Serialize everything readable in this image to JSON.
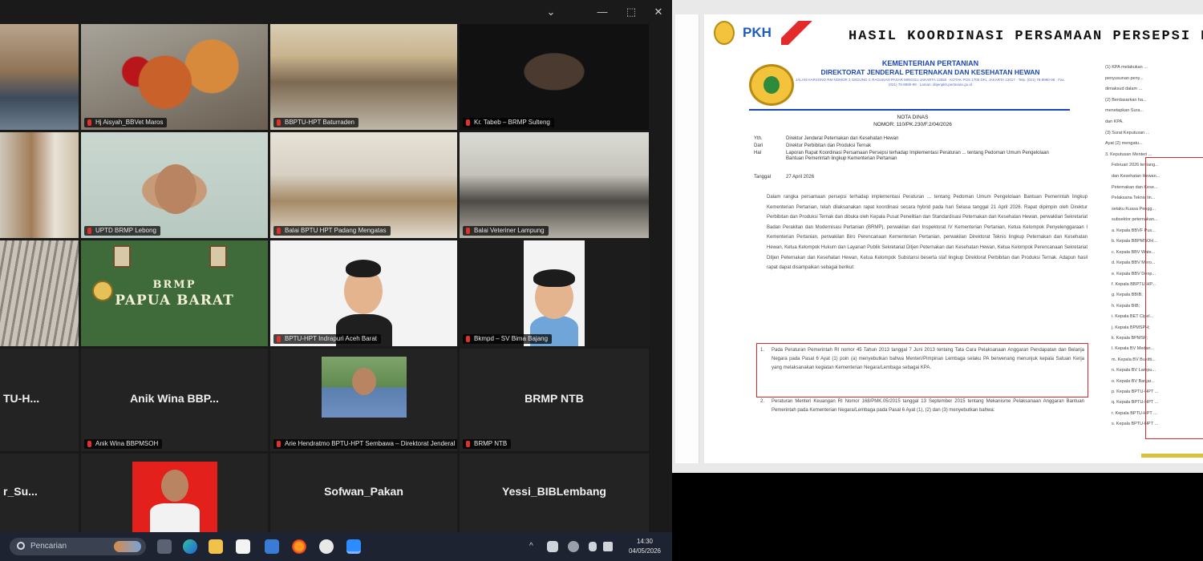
{
  "meeting": {
    "window_controls": [
      "⌄",
      "—",
      "⬚",
      "✕"
    ],
    "tiles": [
      {
        "label": ""
      },
      {
        "label": "Hj Aisyah_BBVet Maros"
      },
      {
        "label": "BBPTU-HPT Baturraden"
      },
      {
        "label": "Kr. Tabeb – BRMP Sulteng"
      },
      {
        "label": ""
      },
      {
        "label": "UPTD BRMP Lebong"
      },
      {
        "label": "Balai BPTU HPT Padang Mengatas"
      },
      {
        "label": "Balai Veteriner Lampung"
      },
      {
        "label": ""
      },
      {
        "label": ""
      },
      {
        "label": "BPTU-HPT Indrapuri Aceh Barat"
      },
      {
        "label": "Bkmpd – SV Bima Bajang"
      }
    ],
    "brmp_sign": {
      "line1": "BRMP",
      "line2": "PAPUA BARAT"
    },
    "name_tiles": [
      {
        "big": "TU-H...",
        "label": ""
      },
      {
        "big": "Anik Wina BBP...",
        "label": "Anik Wina BBPMSOH"
      },
      {
        "big": "",
        "label": "Arie Hendratmo BPTU-HPT Sembawa – Direktorat Jenderal PKH"
      },
      {
        "big": "BRMP NTB",
        "label": "BRMP NTB"
      },
      {
        "big": "r_Su...",
        "label": ""
      },
      {
        "big": "",
        "label": ""
      },
      {
        "big": "Sofwan_Pakan",
        "label": ""
      },
      {
        "big": "Yessi_BIBLembang",
        "label": ""
      }
    ]
  },
  "taskbar": {
    "search_placeholder": "Pencarian",
    "clock_time": "14:30",
    "clock_date": "04/05/2026",
    "tray_chevron": "^"
  },
  "document": {
    "title": "HASIL KOORDINASI PERSAMAAN PERSEPSI PERM",
    "logos": [
      "PKH"
    ],
    "letterhead": {
      "kementerian": "KEMENTERIAN PERTANIAN",
      "direktorat": "DIREKTORAT JENDERAL PETERNAKAN DAN KESEHATAN HEWAN",
      "address": "JALAN HARSONO RM NOMOR 3 GEDUNG C RAGUNAN PASAR MINGGU JAKARTA 12550 · KOTAK POS 1705 DKI, JAKARTA 12017 · Telp. (021) 78-8990-98 · Fax. (021) 78-8990-98 · Laman: ditjenpkh.pertanian.go.id"
    },
    "nota": {
      "title": "NOTA DINAS",
      "nomor": "NOMOR: 110/PK.230/F.2/04/2026"
    },
    "header_rows": [
      {
        "k": "Yth.",
        "v": "Direktur Jenderal Peternakan dan Kesehatan Hewan"
      },
      {
        "k": "Dari",
        "v": "Direktur Perbibitan dan Produksi Ternak"
      },
      {
        "k": "Hal",
        "v": "Laporan Rapat Koordinasi Persamaan Persepsi terhadap Implementasi Peraturan ... tentang Pedoman Umum Pengelolaan Bantuan Pemerintah lingkup Kementerian Pertanian"
      },
      {
        "k": "Tanggal",
        "v": "27 April 2026"
      }
    ],
    "body_paragraph": "Dalam rangka persamaan persepsi terhadap implementasi Peraturan ... tentang Pedoman Umum Pengelolaan Bantuan Pemerintah lingkup Kementerian Pertanian, telah dilaksanakan rapat koordinasi secara hybrid pada hari Selasa tanggal 21 April 2026. Rapat dipimpin oleh Direktur Perbibitan dan Produksi Ternak dan dibuka oleh Kepala Pusat Penelitian dan Standardisasi Peternakan dan Kesehatan Hewan, perwakilan Sekretariat Badan Perakitan dan Modernisasi Pertanian (BRMP), perwakilan dari Inspektorat IV Kementerian Pertanian, Ketua Kelompok Penyelenggaraan I Kementerian Pertanian, perwakilan Biro Perencanaan Kementerian Pertanian, perwakilan Direktorat Teknis lingkup Peternakan dan Kesehatan Hewan, Ketua Kelompok Hukum dan Layanan Publik Sekretariat Ditjen Peternakan dan Kesehatan Hewan, Ketua Kelompok Perencanaan Sekretariat Ditjen Peternakan dan Kesehatan Hewan, Ketua Kelompok Substansi beserta staf lingkup Direktorat Perbibitan dan Produksi Ternak. Adapun hasil rapat dapat disampaikan sebagai berikut:",
    "items": [
      {
        "n": "1.",
        "t": "Pada Peraturan Pemerintah RI nomor 45 Tahun 2013 tanggal 7 Juni 2013 tentang Tata Cara Pelaksanaan Anggaran Pendapatan dan Belanja Negara pada Pasal 6 Ayat (1) poin (a) menyebutkan bahwa Menteri/Pimpinan Lembaga selaku PA berwenang menunjuk kepala Satuan Kerja yang melaksanakan kegiatan Kementerian Negara/Lembaga sebagai KPA."
      },
      {
        "n": "2.",
        "t": "Peraturan Menteri Keuangan RI Nomor 168/PMK.05/2015 tanggal 13 September 2015 tentang Mekanisme Pelaksanaan Anggaran Bantuan Pemerintah pada Kementerian Negara/Lembaga pada Pasal 6 Ayat (1), (2) dan (3) menyebutkan bahwa:"
      }
    ],
    "right_column": [
      "(1) KPA melakukan ...",
      "penyusunan peny...",
      "dimaksud dalam ...",
      "(2) Berdasarkan ha...",
      "menetapkan Sura...",
      "dan KPA.",
      "(3) Surat Keputusan ...",
      "Ayat (2) mengatu...",
      "3. Keputusan Menteri ...",
      "Februari 2026 tentang...",
      "dan Kesehatan Hewan...",
      "Peternakan dan Kese...",
      "Pelaksana Teknis lin...",
      "selaku Kuasa Pengg...",
      "subsektor peternakan...",
      "a. Kepala BBVF Pus...",
      "b. Kepala BBPMSOH...",
      "c. Kepala BBV Wate...",
      "d. Kepala BBV Mero...",
      "e. Kepala BBV Denp...",
      "f. Kepala BBPTU-HP...",
      "g. Kepala BBIB;",
      "h. Kepala BIB;",
      "i. Kepala BET Cipel...",
      "j. Kepala BPMSPH;",
      "k. Kepala BPMSP;",
      "l. Kepala BV Medan...",
      "m. Kepala BV Bukitti...",
      "n. Kepala BV Lampu...",
      "o. Kepala BV Banjar...",
      "p. Kepala BPTU-HPT ...",
      "q. Kepala BPTU-HPT ...",
      "r. Kepala BPTU-HPT ...",
      "s. Kepala BPTU-HPT ..."
    ]
  },
  "colors": {
    "accent_red": "#d92b2b",
    "letterhead_blue": "#1a47b8",
    "mic_muted": "#e0322c",
    "taskbar": "#1d2330"
  }
}
